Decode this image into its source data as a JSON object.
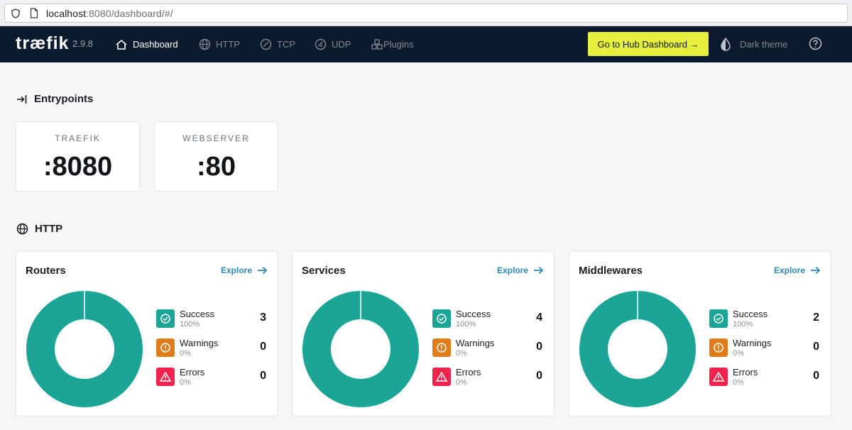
{
  "browser": {
    "url_host": "localhost",
    "url_rest": ":8080/dashboard/#/"
  },
  "navbar": {
    "logo": "træfik",
    "version": "2.9.8",
    "items": [
      {
        "label": "Dashboard",
        "icon": "home-icon",
        "active": true
      },
      {
        "label": "HTTP",
        "icon": "globe-icon"
      },
      {
        "label": "TCP",
        "icon": "tcp-icon"
      },
      {
        "label": "UDP",
        "icon": "udp-icon"
      },
      {
        "label": "Plugins",
        "icon": "plugins-icon"
      }
    ],
    "hub_button": "Go to Hub Dashboard →",
    "theme_toggle": "Dark theme"
  },
  "entrypoints": {
    "title": "Entrypoints",
    "items": [
      {
        "name": "TRAEFIK",
        "port": ":8080"
      },
      {
        "name": "WEBSERVER",
        "port": ":80"
      }
    ]
  },
  "http": {
    "title": "HTTP",
    "cards": [
      {
        "title": "Routers",
        "explore": "Explore",
        "stats": [
          {
            "label": "Success",
            "pct": "100%",
            "count": "3"
          },
          {
            "label": "Warnings",
            "pct": "0%",
            "count": "0"
          },
          {
            "label": "Errors",
            "pct": "0%",
            "count": "0"
          }
        ]
      },
      {
        "title": "Services",
        "explore": "Explore",
        "stats": [
          {
            "label": "Success",
            "pct": "100%",
            "count": "4"
          },
          {
            "label": "Warnings",
            "pct": "0%",
            "count": "0"
          },
          {
            "label": "Errors",
            "pct": "0%",
            "count": "0"
          }
        ]
      },
      {
        "title": "Middlewares",
        "explore": "Explore",
        "stats": [
          {
            "label": "Success",
            "pct": "100%",
            "count": "2"
          },
          {
            "label": "Warnings",
            "pct": "0%",
            "count": "0"
          },
          {
            "label": "Errors",
            "pct": "0%",
            "count": "0"
          }
        ]
      }
    ]
  },
  "colors": {
    "navbar": "#0c1a2e",
    "accent": "#e6f03c",
    "success": "#1aa596",
    "warning": "#e07b1a",
    "error": "#f1224c",
    "link": "#2f89b5"
  }
}
